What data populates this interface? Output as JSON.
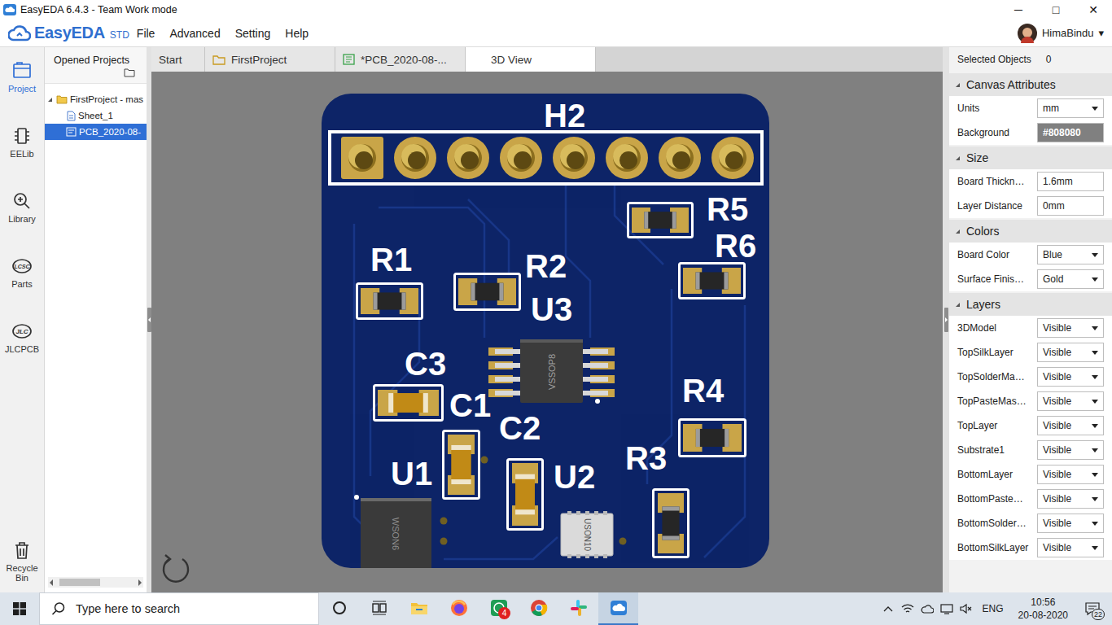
{
  "window": {
    "title": "EasyEDA 6.4.3 - Team Work mode",
    "controls": [
      "─",
      "□",
      "✕"
    ]
  },
  "menubar": {
    "logo": "EasyEDA",
    "edition": "STD",
    "items": [
      "File",
      "Advanced",
      "Setting",
      "Help"
    ],
    "user": "HimaBindu",
    "user_caret": "▾"
  },
  "rail": [
    {
      "label": "Project",
      "kind": "project",
      "selected": true
    },
    {
      "label": "EELib",
      "kind": "eelib",
      "selected": false
    },
    {
      "label": "Library",
      "kind": "library",
      "selected": false
    },
    {
      "label": "Parts",
      "kind": "lcsc",
      "icon_text": "LCSC",
      "selected": false
    },
    {
      "label": "JLCPCB",
      "kind": "jlc",
      "icon_text": "JLC",
      "selected": false
    },
    {
      "label": "Recycle Bin",
      "kind": "bin",
      "selected": false
    }
  ],
  "project_panel": {
    "title": "Opened Projects",
    "tree": [
      {
        "label": "FirstProject - mas",
        "kind": "folder",
        "expanded": true,
        "selected": false
      },
      {
        "label": "Sheet_1",
        "kind": "schematic",
        "selected": false
      },
      {
        "label": "PCB_2020-08-",
        "kind": "pcb",
        "selected": true
      }
    ]
  },
  "tabs": [
    {
      "label": "Start",
      "kind": "start",
      "selected": false
    },
    {
      "label": "FirstProject",
      "kind": "folder",
      "selected": false
    },
    {
      "label": "*PCB_2020-08-...",
      "kind": "pcb",
      "selected": false
    },
    {
      "label": "3D View",
      "kind": "view",
      "selected": true
    }
  ],
  "canvas": {
    "color": "#808080"
  },
  "board": {
    "header": {
      "label": "H2",
      "pins": [
        {
          "square": true
        },
        {
          "square": false
        },
        {
          "square": false
        },
        {
          "square": false
        },
        {
          "square": false
        },
        {
          "square": false
        },
        {
          "square": false
        },
        {
          "square": false
        }
      ]
    },
    "parts": [
      {
        "label": "R5",
        "kind": "resistor"
      },
      {
        "label": "R6",
        "kind": "resistor"
      },
      {
        "label": "R1",
        "kind": "resistor"
      },
      {
        "label": "R2",
        "kind": "resistor"
      },
      {
        "label": "U3",
        "kind": "vssop",
        "marking": "VSSOP8"
      },
      {
        "label": "C3",
        "kind": "capacitor"
      },
      {
        "label": "R4",
        "kind": "resistor"
      },
      {
        "label": "C1",
        "kind": "capacitor"
      },
      {
        "label": "C2",
        "kind": "capacitor"
      },
      {
        "label": "U1",
        "kind": "wson",
        "marking": "WSON6"
      },
      {
        "label": "U2",
        "kind": "uson",
        "marking": "USON10"
      },
      {
        "label": "R3",
        "kind": "resistor"
      }
    ]
  },
  "properties": {
    "selected_label": "Selected Objects",
    "selected_count": "0",
    "sections": [
      {
        "title": "Canvas Attributes",
        "expanded": true,
        "rows": [
          {
            "label": "Units",
            "value": "mm",
            "kind": "select"
          },
          {
            "label": "Background",
            "value": "#808080",
            "kind": "color",
            "color": "#808080"
          }
        ]
      },
      {
        "title": "Size",
        "expanded": true,
        "rows": [
          {
            "label": "Board Thickn…",
            "value": "1.6mm",
            "kind": "input"
          },
          {
            "label": "Layer Distance",
            "value": "0mm",
            "kind": "input"
          }
        ]
      },
      {
        "title": "Colors",
        "expanded": true,
        "rows": [
          {
            "label": "Board Color",
            "value": "Blue",
            "kind": "select"
          },
          {
            "label": "Surface Finis…",
            "value": "Gold",
            "kind": "select"
          }
        ]
      },
      {
        "title": "Layers",
        "expanded": true,
        "rows": [
          {
            "label": "3DModel",
            "value": "Visible",
            "kind": "select"
          },
          {
            "label": "TopSilkLayer",
            "value": "Visible",
            "kind": "select"
          },
          {
            "label": "TopSolderMa…",
            "value": "Visible",
            "kind": "select"
          },
          {
            "label": "TopPasteMas…",
            "value": "Visible",
            "kind": "select"
          },
          {
            "label": "TopLayer",
            "value": "Visible",
            "kind": "select"
          },
          {
            "label": "Substrate1",
            "value": "Visible",
            "kind": "select"
          },
          {
            "label": "BottomLayer",
            "value": "Visible",
            "kind": "select"
          },
          {
            "label": "BottomPaste…",
            "value": "Visible",
            "kind": "select"
          },
          {
            "label": "BottomSolder…",
            "value": "Visible",
            "kind": "select"
          },
          {
            "label": "BottomSilkLayer",
            "value": "Visible",
            "kind": "select"
          }
        ]
      }
    ]
  },
  "taskbar": {
    "search_placeholder": "Type here to search",
    "apps": [
      {
        "kind": "cortana",
        "active": false
      },
      {
        "kind": "taskview",
        "active": false
      },
      {
        "kind": "explorer",
        "active": false
      },
      {
        "kind": "firefox",
        "active": false
      },
      {
        "kind": "whatsapp",
        "active": false,
        "badge": "4"
      },
      {
        "kind": "chrome",
        "active": false
      },
      {
        "kind": "slack",
        "active": false
      },
      {
        "kind": "easyeda",
        "active": true
      }
    ],
    "tray": {
      "language": "ENG",
      "time": "10:56",
      "date": "20-08-2020",
      "notifications": "22"
    }
  }
}
